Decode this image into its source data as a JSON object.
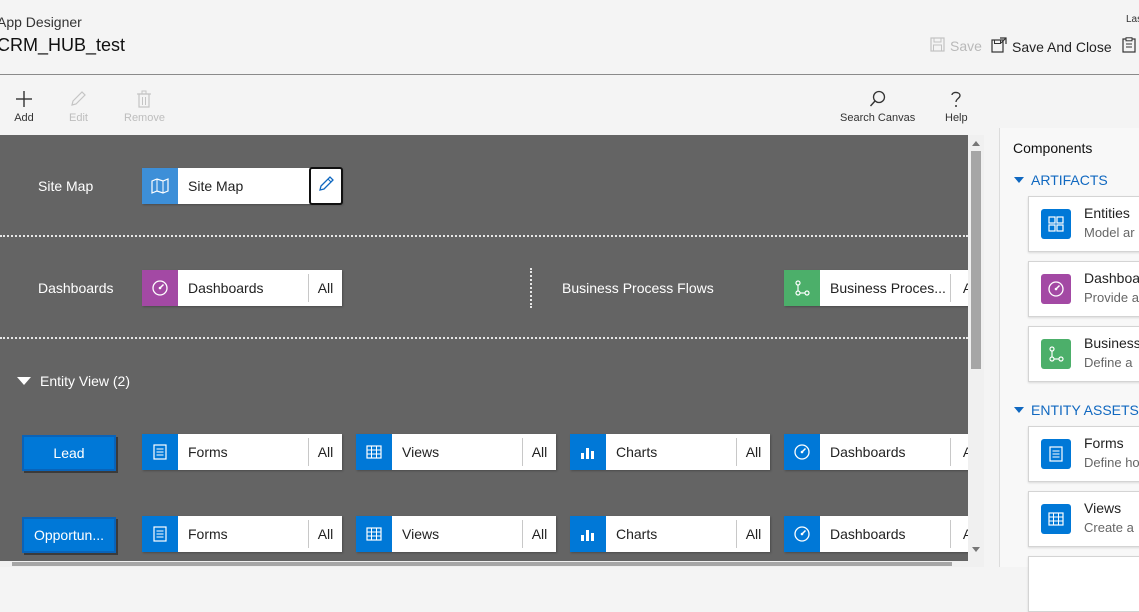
{
  "header": {
    "app_label": "App Designer",
    "app_name": "CRM_HUB_test",
    "last_label": "Las",
    "save_label": "Save",
    "save_close_label": "Save And Close"
  },
  "toolbar": {
    "add_label": "Add",
    "edit_label": "Edit",
    "remove_label": "Remove",
    "search_label": "Search Canvas",
    "help_label": "Help"
  },
  "canvas": {
    "sitemap_row_label": "Site Map",
    "sitemap_tile": "Site Map",
    "dashboards_row_label": "Dashboards",
    "dashboards_tile": "Dashboards",
    "dashboards_all": "All",
    "bpf_row_label": "Business Process Flows",
    "bpf_tile": "Business Proces...",
    "bpf_all": "A",
    "entity_view_label": "Entity View (2)",
    "entities": [
      {
        "name": "Lead",
        "forms": "Forms",
        "forms_all": "All",
        "views": "Views",
        "views_all": "All",
        "charts": "Charts",
        "charts_all": "All",
        "dashboards": "Dashboards",
        "dashboards_all": "A"
      },
      {
        "name": "Opportun...",
        "forms": "Forms",
        "forms_all": "All",
        "views": "Views",
        "views_all": "All",
        "charts": "Charts",
        "charts_all": "All",
        "dashboards": "Dashboards",
        "dashboards_all": "A"
      }
    ]
  },
  "components": {
    "title": "Components",
    "artifacts_title": "ARTIFACTS",
    "artifacts": [
      {
        "name": "Entities",
        "desc": "Model ar",
        "icon": "entities-icon",
        "color": "#0078d7"
      },
      {
        "name": "Dashboa",
        "desc": "Provide a",
        "icon": "dashboard-icon",
        "color": "#a349a4"
      },
      {
        "name": "Business",
        "desc": "Define a",
        "icon": "process-flow-icon",
        "color": "#4caf6a"
      }
    ],
    "entity_assets_title": "ENTITY ASSETS",
    "entity_assets": [
      {
        "name": "Forms",
        "desc": "Define ho",
        "icon": "form-icon",
        "color": "#0078d7"
      },
      {
        "name": "Views",
        "desc": "Create a",
        "icon": "view-icon",
        "color": "#0078d7"
      }
    ]
  },
  "colors": {
    "canvas_bg": "#646464",
    "accent_blue": "#0078d7",
    "sitemap_icon": "#3d8fd8",
    "dashboard_purple": "#a349a4",
    "bpf_green": "#4caf6a",
    "section_blue": "#1068c0"
  }
}
